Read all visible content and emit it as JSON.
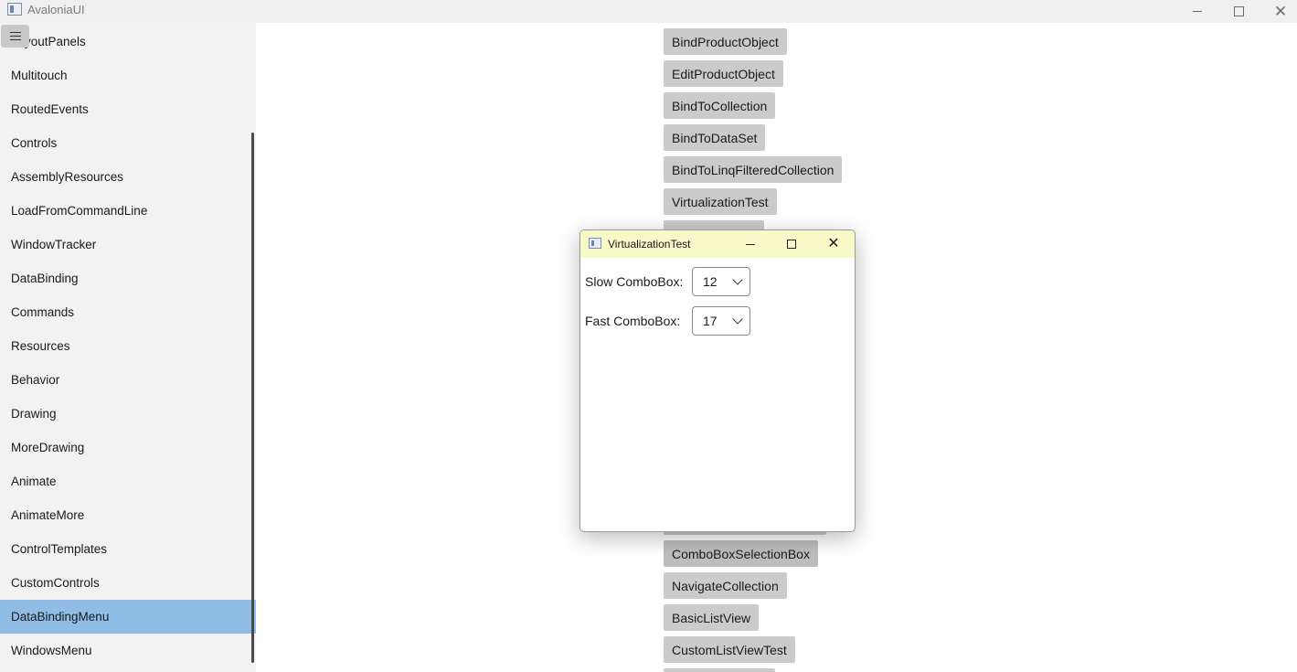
{
  "window": {
    "title": "AvaloniaUI",
    "controls": {
      "minimize": "minimize",
      "maximize": "maximize",
      "close": "close"
    }
  },
  "sidebar": {
    "items": [
      {
        "label": "LayoutPanels"
      },
      {
        "label": "Multitouch"
      },
      {
        "label": "RoutedEvents"
      },
      {
        "label": "Controls"
      },
      {
        "label": "AssemblyResources"
      },
      {
        "label": "LoadFromCommandLine"
      },
      {
        "label": "WindowTracker"
      },
      {
        "label": "DataBinding"
      },
      {
        "label": "Commands"
      },
      {
        "label": "Resources"
      },
      {
        "label": "Behavior"
      },
      {
        "label": "Drawing"
      },
      {
        "label": "MoreDrawing"
      },
      {
        "label": "Animate"
      },
      {
        "label": "AnimateMore"
      },
      {
        "label": "ControlTemplates"
      },
      {
        "label": "CustomControls"
      },
      {
        "label": "DataBindingMenu",
        "selected": true
      },
      {
        "label": "WindowsMenu"
      }
    ],
    "selected_color": "#8fbde6"
  },
  "content": {
    "buttons": [
      {
        "label": "BindProductObject"
      },
      {
        "label": "EditProductObject"
      },
      {
        "label": "BindToCollection"
      },
      {
        "label": "BindToDataSet"
      },
      {
        "label": "BindToLinqFilteredCollection"
      },
      {
        "label": "VirtualizationTest"
      },
      {
        "label": "ComboBoxSelectionBox"
      },
      {
        "label": "NavigateCollection"
      },
      {
        "label": "BasicListView"
      },
      {
        "label": "CustomListViewTest"
      }
    ]
  },
  "dialog": {
    "title": "VirtualizationTest",
    "titlebar_color": "#f8f8c9",
    "slow": {
      "label": "Slow ComboBox:",
      "value": "12"
    },
    "fast": {
      "label": "Fast ComboBox:",
      "value": "17"
    }
  }
}
